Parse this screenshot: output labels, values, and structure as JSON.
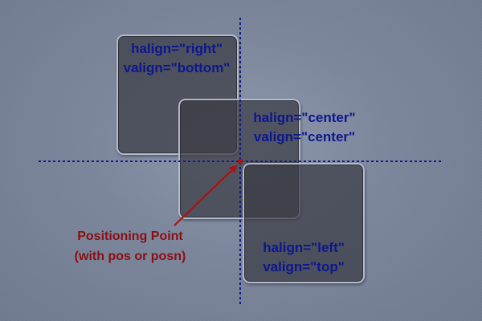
{
  "boxes": [
    {
      "halign": "halign=\"right\"",
      "valign": "valign=\"bottom\""
    },
    {
      "halign": "halign=\"center\"",
      "valign": "valign=\"center\""
    },
    {
      "halign": "halign=\"left\"",
      "valign": "valign=\"top\""
    }
  ],
  "annotation": {
    "line1": "Positioning Point",
    "line2": "(with pos or posn)"
  },
  "colors": {
    "background": "#7c879d",
    "guide_line": "#141a8c",
    "label_text": "#0d168f",
    "annotation_text": "#8c0e12",
    "positioning_point": "#b01010",
    "box_fill": "#3a3c44",
    "box_border": "#c8ceda"
  }
}
